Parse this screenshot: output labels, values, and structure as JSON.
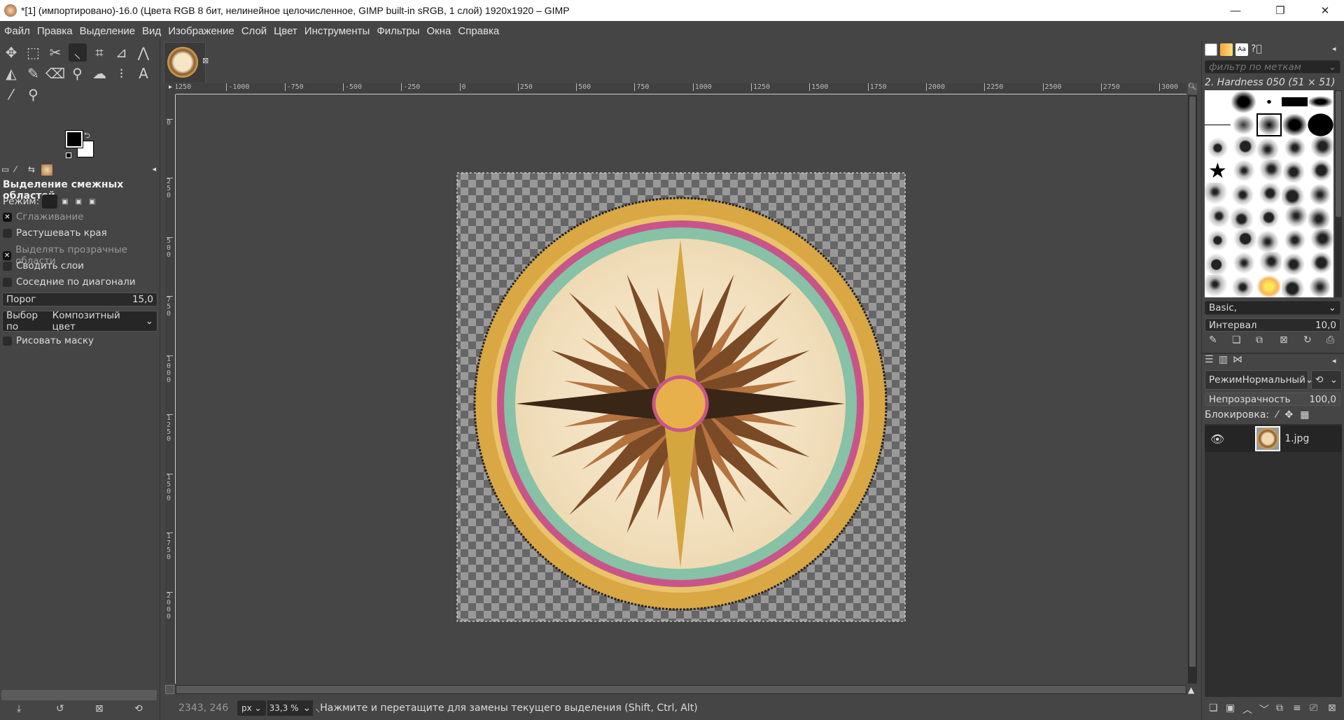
{
  "window": {
    "title": "*[1] (импортировано)-16.0 (Цвета RGB 8 бит, нелинейное целочисленное, GIMP built-in sRGB, 1 слой) 1920x1920 – GIMP",
    "minimize": "—",
    "maximize": "❐",
    "close": "✕"
  },
  "menu": [
    "Файл",
    "Правка",
    "Выделение",
    "Вид",
    "Изображение",
    "Слой",
    "Цвет",
    "Инструменты",
    "Фильтры",
    "Окна",
    "Справка"
  ],
  "toolbox": {
    "tools": [
      "move-icon",
      "rect-select-icon",
      "scissors-icon",
      "fuzzy-select-icon",
      "crop-icon",
      "transform-icon",
      "warp-icon",
      "bucket-fill-icon",
      "paint-icon",
      "eraser-icon",
      "clone-icon",
      "smudge-icon",
      "paths-icon",
      "text-icon",
      "color-picker-icon",
      "zoom-icon"
    ],
    "active_tool": "fuzzy-select-icon",
    "fg_color": "#000000",
    "bg_color": "#ffffff"
  },
  "tool_options": {
    "title": "Выделение смежных областей",
    "mode_label": "Режим:",
    "checkboxes": [
      {
        "label": "Сглаживание",
        "checked": true
      },
      {
        "label": "Растушевать края",
        "checked": false
      },
      {
        "label": "Выделять прозрачные области",
        "checked": true
      },
      {
        "label": "Сводить слои",
        "checked": false
      },
      {
        "label": "Соседние по диагонали",
        "checked": false
      }
    ],
    "threshold_label": "Порог",
    "threshold_value": "15,0",
    "select_by_label": "Выбор по",
    "select_by_value": "Композитный цвет",
    "draw_mask_label": "Рисовать маску"
  },
  "canvas": {
    "ruler_top": [
      "-1250",
      "-1000",
      "-750",
      "-500",
      "-250",
      "0",
      "250",
      "500",
      "750",
      "1000",
      "1250",
      "1500",
      "1750",
      "2000",
      "2250",
      "2500",
      "2750",
      "3000"
    ],
    "ruler_left": [
      "-250",
      "0",
      "250",
      "500",
      "750",
      "1000",
      "1250",
      "1500",
      "1750",
      "2000"
    ]
  },
  "status": {
    "coords": "2343, 246",
    "unit": "px",
    "zoom": "33,3 %",
    "message": "Нажмите и перетащите для замены текущего выделения (Shift, Ctrl, Alt)"
  },
  "brushes": {
    "filter_placeholder": "фильтр по меткам",
    "current": "2. Hardness 050 (51 × 51)",
    "preset": "Basic,",
    "spacing_label": "Интервал",
    "spacing_value": "10,0"
  },
  "layers": {
    "mode_label": "Режим",
    "mode_value": "Нормальный",
    "opacity_label": "Непрозрачность",
    "opacity_value": "100,0",
    "lock_label": "Блокировка:",
    "items": [
      {
        "name": "1.jpg",
        "visible": true
      }
    ]
  }
}
